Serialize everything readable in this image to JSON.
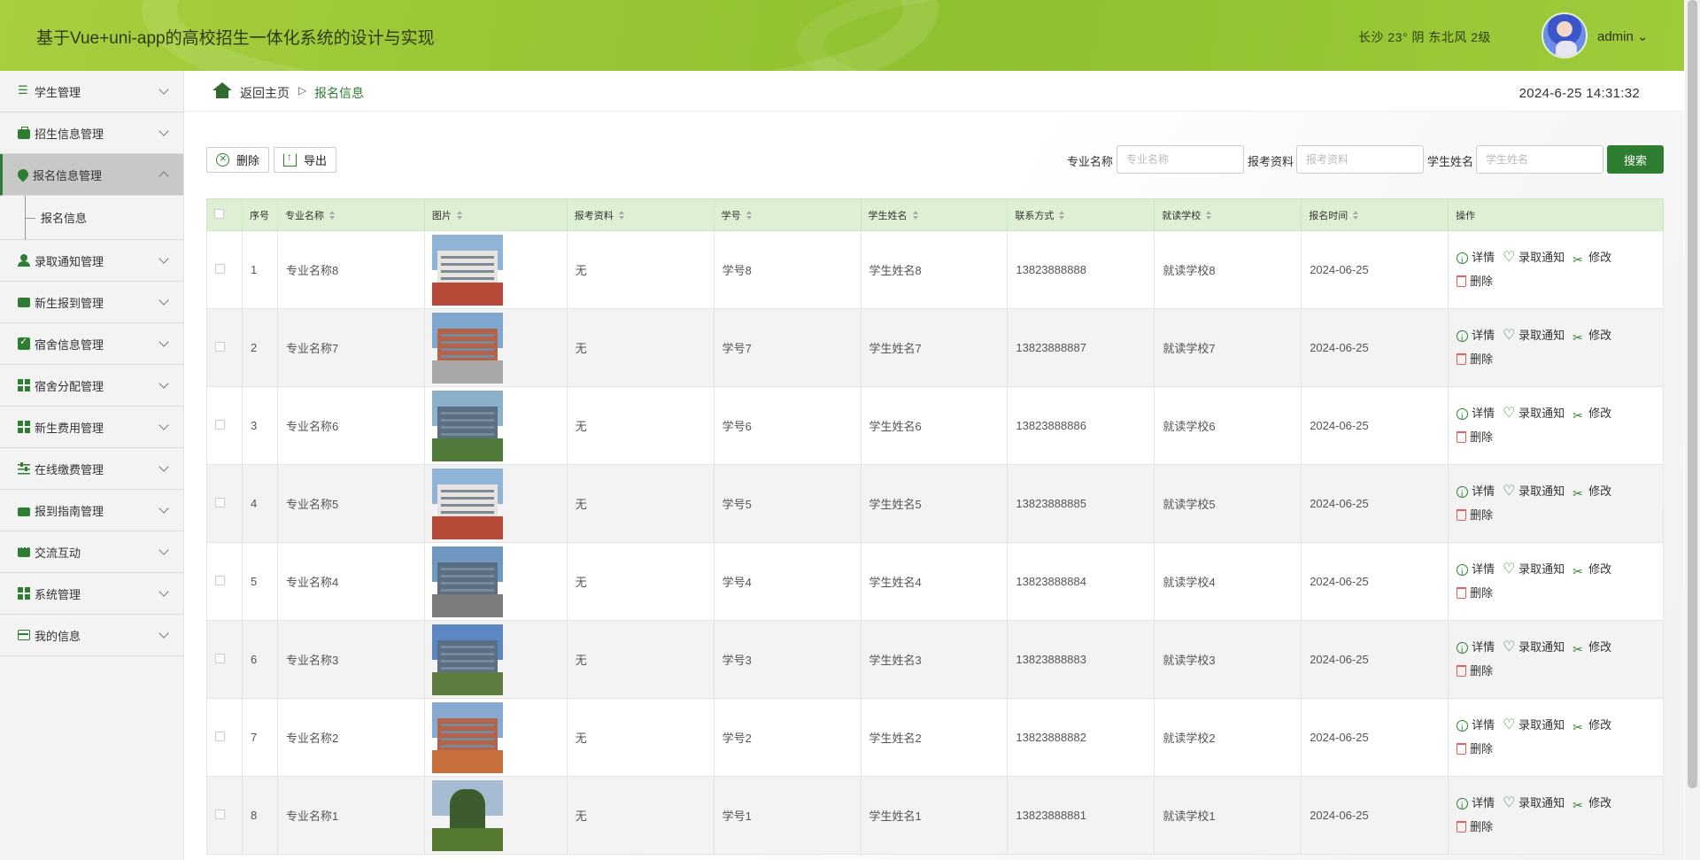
{
  "header": {
    "title": "基于Vue+uni-app的高校招生一体化系统的设计与实现",
    "weather": "长沙 23° 阴 东北风 2级",
    "user": "admin ⌄"
  },
  "sidebar": {
    "items": [
      {
        "label": "学生管理",
        "icon": "list-icon"
      },
      {
        "label": "招生信息管理",
        "icon": "briefcase-icon"
      },
      {
        "label": "报名信息管理",
        "icon": "drop-icon"
      },
      {
        "label": "录取通知管理",
        "icon": "user-icon"
      },
      {
        "label": "新生报到管理",
        "icon": "book-icon"
      },
      {
        "label": "宿舍信息管理",
        "icon": "check-icon"
      },
      {
        "label": "宿舍分配管理",
        "icon": "grid-icon"
      },
      {
        "label": "新生费用管理",
        "icon": "grid-icon"
      },
      {
        "label": "在线缴费管理",
        "icon": "slider-icon"
      },
      {
        "label": "报到指南管理",
        "icon": "wallet-icon"
      },
      {
        "label": "交流互动",
        "icon": "chat-icon"
      },
      {
        "label": "系统管理",
        "icon": "grid-icon"
      },
      {
        "label": "我的信息",
        "icon": "card-icon"
      }
    ],
    "submenu": "报名信息"
  },
  "breadcrumb": {
    "home": "返回主页",
    "separator": "▷",
    "current": "报名信息"
  },
  "clock": "2024-6-25 14:31:32",
  "toolbar": {
    "delete_label": "删除",
    "export_label": "导出"
  },
  "search": {
    "major_label": "专业名称",
    "major_placeholder": "专业名称",
    "material_label": "报考资料",
    "material_placeholder": "报考资料",
    "name_label": "学生姓名",
    "name_placeholder": "学生姓名",
    "button": "搜索"
  },
  "table": {
    "headers": {
      "index": "序号",
      "major": "专业名称",
      "image": "图片",
      "material": "报考资料",
      "student_id": "学号",
      "name": "学生姓名",
      "phone": "联系方式",
      "school": "就读学校",
      "time": "报名时间",
      "ops": "操作"
    },
    "op_labels": {
      "detail": "详情",
      "notice": "录取通知",
      "edit": "修改",
      "delete": "删除"
    },
    "rows": [
      {
        "index": "1",
        "major": "专业名称8",
        "material": "无",
        "student_id": "学号8",
        "name": "学生姓名8",
        "phone": "13823888888",
        "school": "就读学校8",
        "time": "2024-06-25"
      },
      {
        "index": "2",
        "major": "专业名称7",
        "material": "无",
        "student_id": "学号7",
        "name": "学生姓名7",
        "phone": "13823888887",
        "school": "就读学校7",
        "time": "2024-06-25"
      },
      {
        "index": "3",
        "major": "专业名称6",
        "material": "无",
        "student_id": "学号6",
        "name": "学生姓名6",
        "phone": "13823888886",
        "school": "就读学校6",
        "time": "2024-06-25"
      },
      {
        "index": "4",
        "major": "专业名称5",
        "material": "无",
        "student_id": "学号5",
        "name": "学生姓名5",
        "phone": "13823888885",
        "school": "就读学校5",
        "time": "2024-06-25"
      },
      {
        "index": "5",
        "major": "专业名称4",
        "material": "无",
        "student_id": "学号4",
        "name": "学生姓名4",
        "phone": "13823888884",
        "school": "就读学校4",
        "time": "2024-06-25"
      },
      {
        "index": "6",
        "major": "专业名称3",
        "material": "无",
        "student_id": "学号3",
        "name": "学生姓名3",
        "phone": "13823888883",
        "school": "就读学校3",
        "time": "2024-06-25"
      },
      {
        "index": "7",
        "major": "专业名称2",
        "material": "无",
        "student_id": "学号2",
        "name": "学生姓名2",
        "phone": "13823888882",
        "school": "就读学校2",
        "time": "2024-06-25"
      },
      {
        "index": "8",
        "major": "专业名称1",
        "material": "无",
        "student_id": "学号1",
        "name": "学生姓名1",
        "phone": "13823888881",
        "school": "就读学校1",
        "time": "2024-06-25"
      }
    ]
  },
  "colors": {
    "header_bg": "#98c535",
    "accent": "#2e7d32",
    "table_header_bg": "#ddf0d3",
    "delete_red": "#e06060"
  }
}
